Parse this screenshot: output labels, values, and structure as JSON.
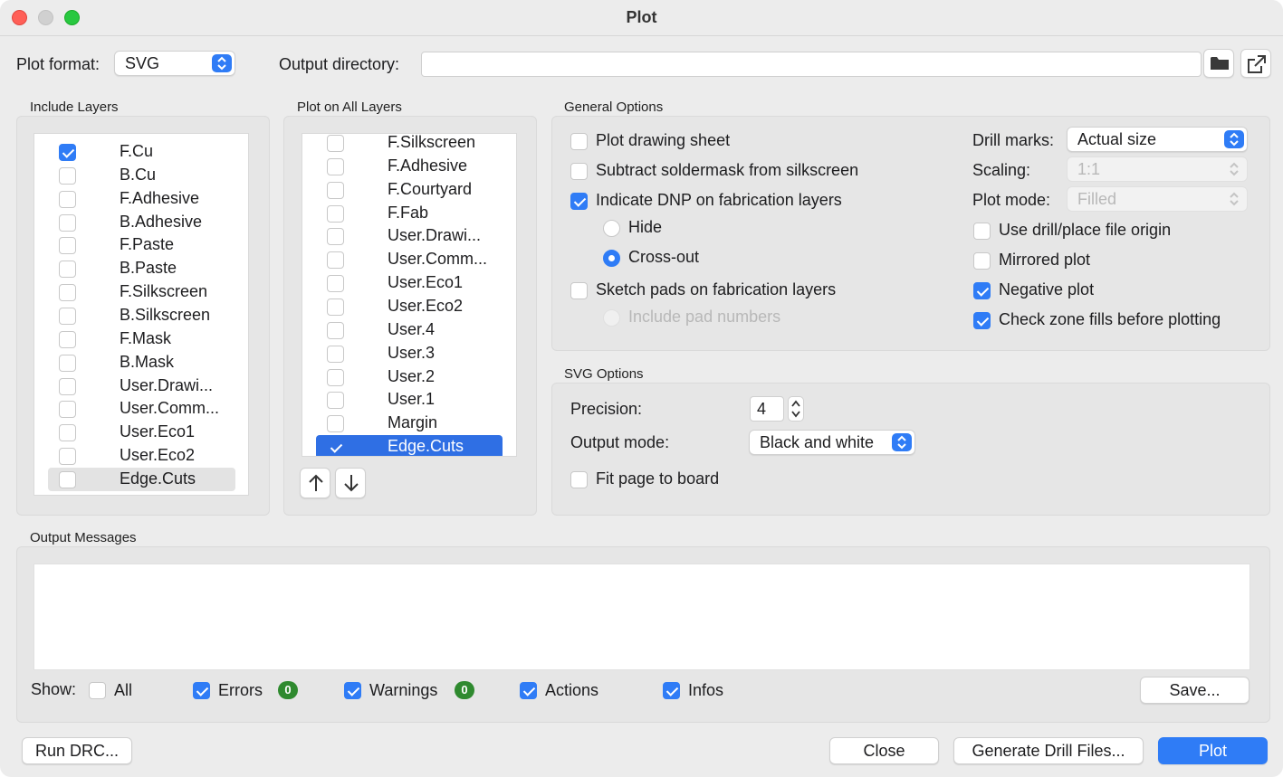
{
  "window": {
    "title": "Plot"
  },
  "top": {
    "plot_format_label": "Plot format:",
    "plot_format_value": "SVG",
    "output_dir_label": "Output directory:",
    "output_dir_value": ""
  },
  "include_layers": {
    "title": "Include Layers",
    "items": [
      {
        "label": "F.Cu",
        "checked": true
      },
      {
        "label": "B.Cu",
        "checked": false
      },
      {
        "label": "F.Adhesive",
        "checked": false
      },
      {
        "label": "B.Adhesive",
        "checked": false
      },
      {
        "label": "F.Paste",
        "checked": false
      },
      {
        "label": "B.Paste",
        "checked": false
      },
      {
        "label": "F.Silkscreen",
        "checked": false
      },
      {
        "label": "B.Silkscreen",
        "checked": false
      },
      {
        "label": "F.Mask",
        "checked": false
      },
      {
        "label": "B.Mask",
        "checked": false
      },
      {
        "label": "User.Drawi...",
        "checked": false
      },
      {
        "label": "User.Comm...",
        "checked": false
      },
      {
        "label": "User.Eco1",
        "checked": false
      },
      {
        "label": "User.Eco2",
        "checked": false
      },
      {
        "label": "Edge.Cuts",
        "checked": false,
        "highlighted": true
      }
    ]
  },
  "plot_all_layers": {
    "title": "Plot on All Layers",
    "items": [
      {
        "label": "F.Silkscreen",
        "checked": false
      },
      {
        "label": "F.Adhesive",
        "checked": false
      },
      {
        "label": "F.Courtyard",
        "checked": false
      },
      {
        "label": "F.Fab",
        "checked": false
      },
      {
        "label": "User.Drawi...",
        "checked": false
      },
      {
        "label": "User.Comm...",
        "checked": false
      },
      {
        "label": "User.Eco1",
        "checked": false
      },
      {
        "label": "User.Eco2",
        "checked": false
      },
      {
        "label": "User.4",
        "checked": false
      },
      {
        "label": "User.3",
        "checked": false
      },
      {
        "label": "User.2",
        "checked": false
      },
      {
        "label": "User.1",
        "checked": false
      },
      {
        "label": "Margin",
        "checked": false
      },
      {
        "label": "Edge.Cuts",
        "checked": true,
        "selected": true
      }
    ]
  },
  "general": {
    "title": "General Options",
    "plot_drawing_sheet": "Plot drawing sheet",
    "subtract_soldermask": "Subtract soldermask from silkscreen",
    "indicate_dnp": "Indicate DNP on fabrication layers",
    "hide": "Hide",
    "cross_out": "Cross-out",
    "sketch_pads": "Sketch pads on fabrication layers",
    "include_pad_numbers": "Include pad numbers",
    "drill_marks_label": "Drill marks:",
    "drill_marks_value": "Actual size",
    "scaling_label": "Scaling:",
    "scaling_value": "1:1",
    "plot_mode_label": "Plot mode:",
    "plot_mode_value": "Filled",
    "use_drill_origin": "Use drill/place file origin",
    "mirrored_plot": "Mirrored plot",
    "negative_plot": "Negative plot",
    "check_zone_fills": "Check zone fills before plotting"
  },
  "svg": {
    "title": "SVG Options",
    "precision_label": "Precision:",
    "precision_value": "4",
    "output_mode_label": "Output mode:",
    "output_mode_value": "Black and white",
    "fit_page": "Fit page to board"
  },
  "messages": {
    "title": "Output Messages",
    "show_label": "Show:",
    "all": "All",
    "errors": "Errors",
    "errors_count": "0",
    "warnings": "Warnings",
    "warnings_count": "0",
    "actions": "Actions",
    "infos": "Infos",
    "save": "Save..."
  },
  "footer": {
    "run_drc": "Run DRC...",
    "close": "Close",
    "generate_drill": "Generate Drill Files...",
    "plot": "Plot"
  },
  "colors": {
    "accent": "#2f7cf6",
    "badge": "#2f8a2f"
  }
}
